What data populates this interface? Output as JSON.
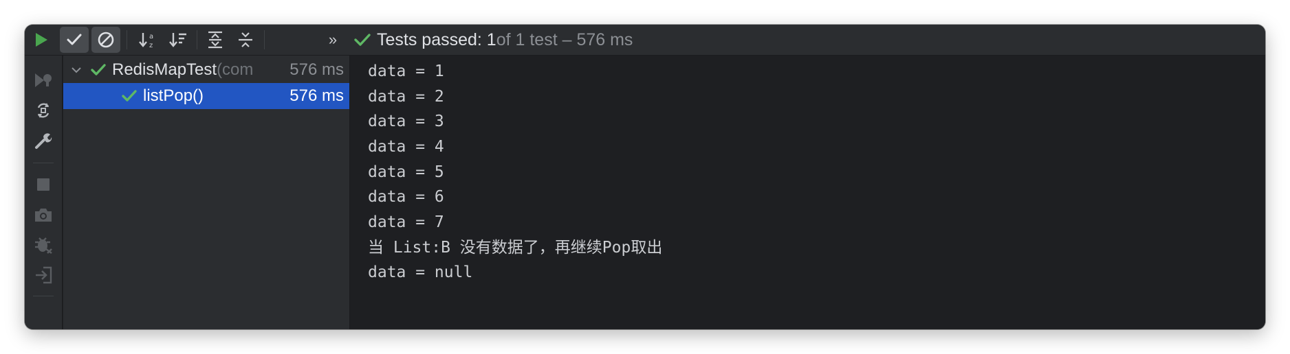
{
  "toolbar": {
    "buttons": [
      {
        "name": "run-icon",
        "label": "Run"
      },
      {
        "name": "show-passed-icon",
        "label": "Show Passed"
      },
      {
        "name": "show-ignored-icon",
        "label": "Show Ignored"
      },
      {
        "name": "sort-alpha-icon",
        "label": "Sort Alphabetically"
      },
      {
        "name": "sort-duration-icon",
        "label": "Sort by Duration"
      },
      {
        "name": "expand-all-icon",
        "label": "Expand All"
      },
      {
        "name": "collapse-all-icon",
        "label": "Collapse All"
      },
      {
        "name": "more-icon",
        "label": "More"
      }
    ],
    "status_prefix": "Tests passed: 1",
    "status_suffix": " of 1 test – 576 ms"
  },
  "gutter": {
    "icons": [
      "rerun-failed-icon",
      "rerun-toggle-icon",
      "settings-wrench-icon",
      "stop-icon",
      "camera-icon",
      "debug-icon",
      "export-icon"
    ]
  },
  "tree": {
    "root": {
      "name": "RedisMapTest",
      "extra": " (com",
      "time": "576 ms"
    },
    "children": [
      {
        "name": "listPop()",
        "time": "576 ms",
        "selected": true
      }
    ]
  },
  "console": {
    "lines": [
      "data = 1",
      "data = 2",
      "data = 3",
      "data = 4",
      "data = 5",
      "data = 6",
      "data = 7",
      "当 List:B 没有数据了，再继续Pop取出",
      "data = null"
    ]
  },
  "colors": {
    "pass_green": "#5fb865",
    "selection_blue": "#2256c2",
    "run_green": "#4aa64f"
  }
}
